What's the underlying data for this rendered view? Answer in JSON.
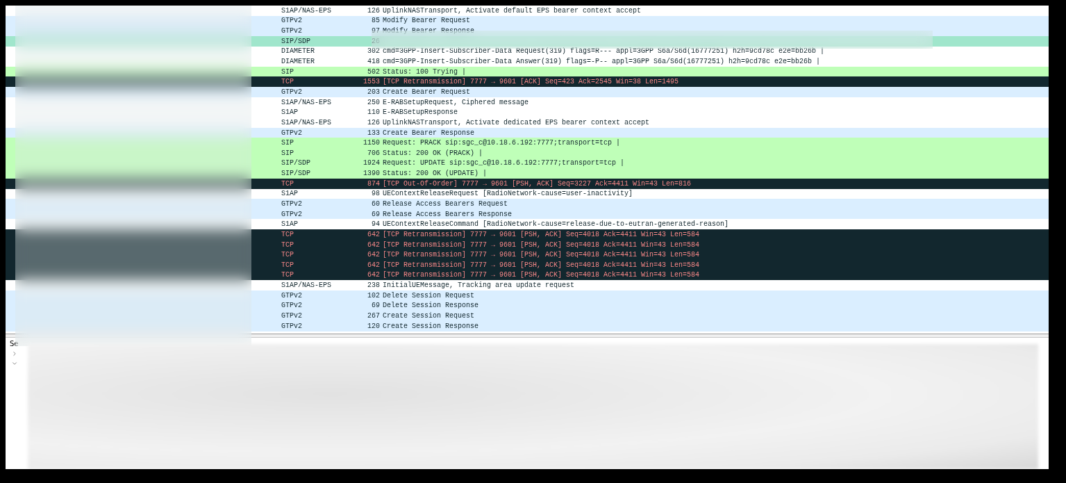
{
  "packet_list": {
    "rows": [
      {
        "kind": "plain",
        "protocol": "S1AP/NAS-EPS",
        "length": "126",
        "info": "UplinkNASTransport, Activate default EPS bearer context accept"
      },
      {
        "kind": "gtp",
        "protocol": "GTPv2",
        "length": "85",
        "info": "Modify Bearer Request"
      },
      {
        "kind": "gtp",
        "protocol": "GTPv2",
        "length": "97",
        "info": "Modify Bearer Response"
      },
      {
        "kind": "marked",
        "protocol": "SIP/SDP",
        "length": "26",
        "info": ""
      },
      {
        "kind": "plain",
        "protocol": "DIAMETER",
        "length": "302",
        "info": "cmd=3GPP-Insert-Subscriber-Data Request(319) flags=R--- appl=3GPP S6a/S6d(16777251) h2h=9cd78c e2e=bb26b |"
      },
      {
        "kind": "plain",
        "protocol": "DIAMETER",
        "length": "418",
        "info": "cmd=3GPP-Insert-Subscriber-Data Answer(319) flags=-P-- appl=3GPP S6a/S6d(16777251) h2h=9cd78c e2e=bb26b |"
      },
      {
        "kind": "sip",
        "protocol": "SIP",
        "length": "502",
        "info": "Status: 100 Trying |"
      },
      {
        "kind": "bad",
        "protocol": "TCP",
        "length": "1553",
        "info": "[TCP Retransmission] 7777 → 9601 [ACK] Seq=423 Ack=2545 Win=38 Len=1495"
      },
      {
        "kind": "gtp",
        "protocol": "GTPv2",
        "length": "203",
        "info": "Create Bearer Request"
      },
      {
        "kind": "plain",
        "protocol": "S1AP/NAS-EPS",
        "length": "250",
        "info": "E-RABSetupRequest, Ciphered message"
      },
      {
        "kind": "plain",
        "protocol": "S1AP",
        "length": "110",
        "info": "E-RABSetupResponse"
      },
      {
        "kind": "plain",
        "protocol": "S1AP/NAS-EPS",
        "length": "126",
        "info": "UplinkNASTransport, Activate dedicated EPS bearer context accept"
      },
      {
        "kind": "gtp",
        "protocol": "GTPv2",
        "length": "133",
        "info": "Create Bearer Response"
      },
      {
        "kind": "sip",
        "protocol": "SIP",
        "length": "1150",
        "info": "Request: PRACK sip:sgc_c@10.18.6.192:7777;transport=tcp |"
      },
      {
        "kind": "sip",
        "protocol": "SIP",
        "length": "706",
        "info": "Status: 200 OK (PRACK) |"
      },
      {
        "kind": "sip",
        "protocol": "SIP/SDP",
        "length": "1924",
        "info": "Request: UPDATE sip:sgc_c@10.18.6.192:7777;transport=tcp |"
      },
      {
        "kind": "sip",
        "protocol": "SIP/SDP",
        "length": "1390",
        "info": "Status: 200 OK (UPDATE) |"
      },
      {
        "kind": "bad",
        "protocol": "TCP",
        "length": "874",
        "info": "[TCP Out-Of-Order] 7777 → 9601 [PSH, ACK] Seq=3227 Ack=4411 Win=43 Len=816"
      },
      {
        "kind": "plain",
        "protocol": "S1AP",
        "length": "98",
        "info": "UEContextReleaseRequest [RadioNetwork-cause=user-inactivity]"
      },
      {
        "kind": "gtp",
        "protocol": "GTPv2",
        "length": "60",
        "info": "Release Access Bearers Request"
      },
      {
        "kind": "gtp",
        "protocol": "GTPv2",
        "length": "69",
        "info": "Release Access Bearers Response"
      },
      {
        "kind": "plain",
        "protocol": "S1AP",
        "length": "94",
        "info": "UEContextReleaseCommand [RadioNetwork-cause=release-due-to-eutran-generated-reason]"
      },
      {
        "kind": "bad",
        "protocol": "TCP",
        "length": "642",
        "info": "[TCP Retransmission] 7777 → 9601 [PSH, ACK] Seq=4018 Ack=4411 Win=43 Len=584"
      },
      {
        "kind": "bad",
        "protocol": "TCP",
        "length": "642",
        "info": "[TCP Retransmission] 7777 → 9601 [PSH, ACK] Seq=4018 Ack=4411 Win=43 Len=584"
      },
      {
        "kind": "bad",
        "protocol": "TCP",
        "length": "642",
        "info": "[TCP Retransmission] 7777 → 9601 [PSH, ACK] Seq=4018 Ack=4411 Win=43 Len=584"
      },
      {
        "kind": "bad",
        "protocol": "TCP",
        "length": "642",
        "info": "[TCP Retransmission] 7777 → 9601 [PSH, ACK] Seq=4018 Ack=4411 Win=43 Len=584"
      },
      {
        "kind": "bad",
        "protocol": "TCP",
        "length": "642",
        "info": "[TCP Retransmission] 7777 → 9601 [PSH, ACK] Seq=4018 Ack=4411 Win=43 Len=584"
      },
      {
        "kind": "plain",
        "protocol": "S1AP/NAS-EPS",
        "length": "238",
        "info": "InitialUEMessage, Tracking area update request"
      },
      {
        "kind": "gtp",
        "protocol": "GTPv2",
        "length": "102",
        "info": "Delete Session Request"
      },
      {
        "kind": "gtp",
        "protocol": "GTPv2",
        "length": "69",
        "info": "Delete Session Response"
      },
      {
        "kind": "gtp",
        "protocol": "GTPv2",
        "length": "267",
        "info": "Create Session Request"
      },
      {
        "kind": "gtp",
        "protocol": "GTPv2",
        "length": "120",
        "info": "Create Session Response"
      }
    ]
  },
  "details": {
    "label": "Se",
    "items": [
      {
        "expanded": false
      },
      {
        "expanded": true
      }
    ]
  }
}
